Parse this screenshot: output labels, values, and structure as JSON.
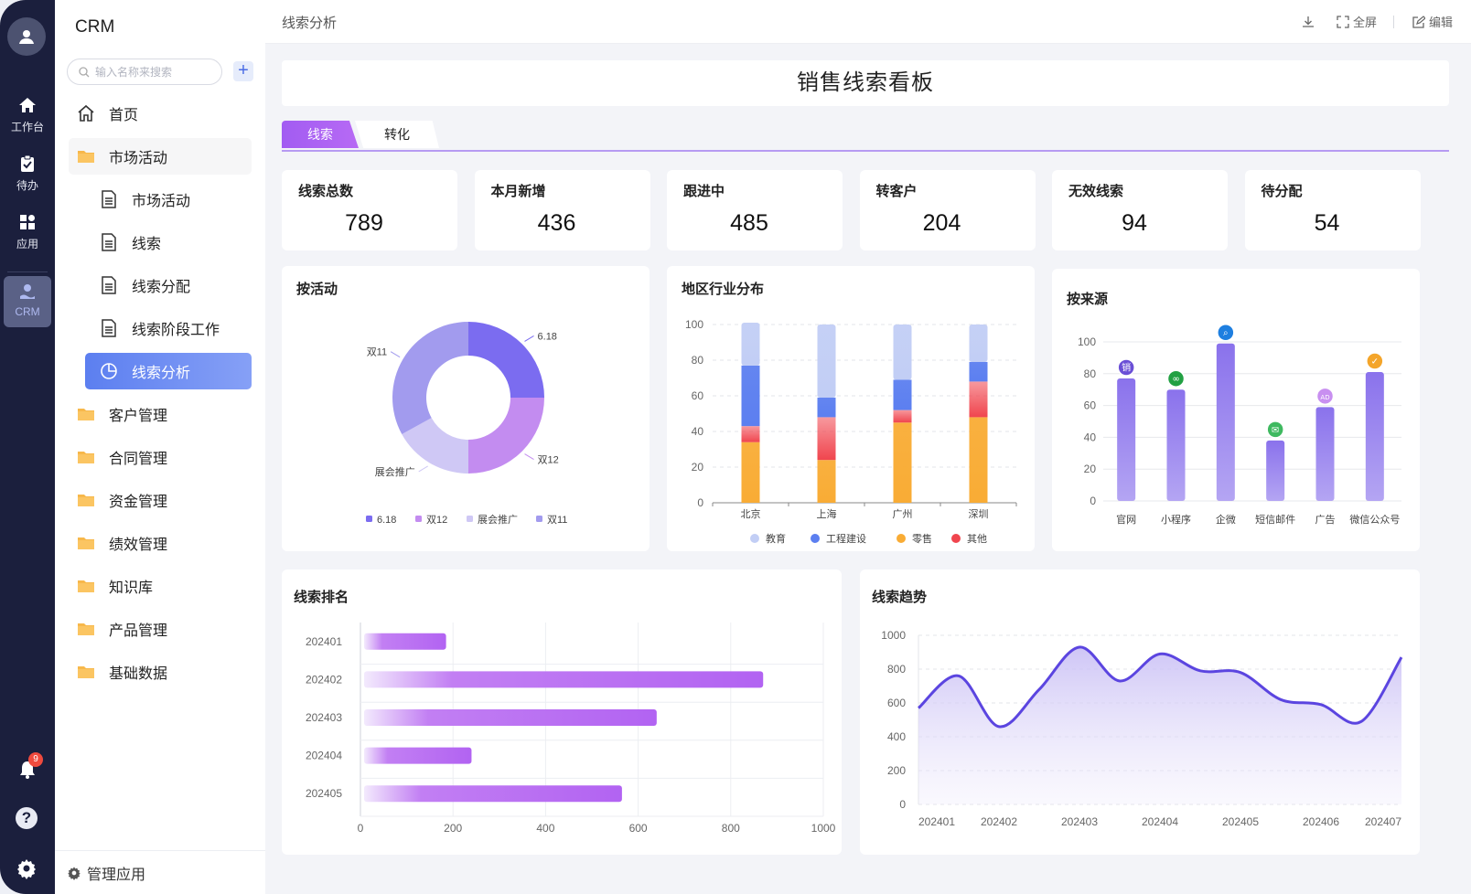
{
  "rail": {
    "items": [
      {
        "label": "工作台",
        "icon": "home-icon"
      },
      {
        "label": "待办",
        "icon": "clipboard-icon"
      },
      {
        "label": "应用",
        "icon": "apps-icon"
      },
      {
        "label": "CRM",
        "icon": "crm-icon"
      }
    ],
    "notification_count": "9"
  },
  "sidebar": {
    "title": "CRM",
    "search_placeholder": "输入名称来搜索",
    "add_label": "+",
    "items": [
      {
        "label": "首页",
        "icon": "house-icon",
        "kind": "top"
      },
      {
        "label": "市场活动",
        "icon": "folder-icon",
        "kind": "folder"
      },
      {
        "label": "市场活动",
        "icon": "document-icon",
        "kind": "sub"
      },
      {
        "label": "线索",
        "icon": "document-icon",
        "kind": "sub"
      },
      {
        "label": "线索分配",
        "icon": "document-icon",
        "kind": "sub"
      },
      {
        "label": "线索阶段工作",
        "icon": "document-icon",
        "kind": "sub"
      },
      {
        "label": "线索分析",
        "icon": "pie-icon",
        "kind": "active"
      },
      {
        "label": "客户管理",
        "icon": "folder-icon",
        "kind": "folder"
      },
      {
        "label": "合同管理",
        "icon": "folder-icon",
        "kind": "folder"
      },
      {
        "label": "资金管理",
        "icon": "folder-icon",
        "kind": "folder"
      },
      {
        "label": "绩效管理",
        "icon": "folder-icon",
        "kind": "folder"
      },
      {
        "label": "知识库",
        "icon": "folder-icon",
        "kind": "folder"
      },
      {
        "label": "产品管理",
        "icon": "folder-icon",
        "kind": "folder"
      },
      {
        "label": "基础数据",
        "icon": "folder-icon",
        "kind": "folder"
      }
    ],
    "footer_label": "管理应用"
  },
  "topbar": {
    "breadcrumb": "线索分析",
    "fullscreen_label": "全屏",
    "edit_label": "编辑"
  },
  "dashboard": {
    "title": "销售线索看板",
    "tabs": [
      "线索",
      "转化"
    ],
    "kpis": [
      {
        "label": "线索总数",
        "value": "789"
      },
      {
        "label": "本月新增",
        "value": "436"
      },
      {
        "label": "跟进中",
        "value": "485"
      },
      {
        "label": "转客户",
        "value": "204"
      },
      {
        "label": "无效线索",
        "value": "94"
      },
      {
        "label": "待分配",
        "value": "54"
      }
    ],
    "colors": {
      "accent": "#a25cf2",
      "blue": "#5c7ff0",
      "orange": "#f9ac35",
      "red": "#f0454e"
    }
  },
  "chart_data": [
    {
      "type": "pie",
      "title": "按活动",
      "categories": [
        "6.18",
        "双12",
        "展会推广",
        "双11"
      ],
      "values": [
        25,
        25,
        17,
        33
      ],
      "colors": [
        "#7b6cf0",
        "#c38cf0",
        "#cfc8f5",
        "#a29bee"
      ],
      "legend": "bottom"
    },
    {
      "type": "bar",
      "stacked": true,
      "title": "地区行业分布",
      "categories": [
        "北京",
        "上海",
        "广州",
        "深圳"
      ],
      "series": [
        {
          "name": "零售",
          "values": [
            34,
            24,
            45,
            48
          ],
          "color": "#f9ac35"
        },
        {
          "name": "其他",
          "values": [
            9,
            24,
            7,
            20
          ],
          "color": "#f0454e"
        },
        {
          "name": "工程建设",
          "values": [
            34,
            11,
            17,
            11
          ],
          "color": "#5c7ff0"
        },
        {
          "name": "教育",
          "values": [
            24,
            41,
            31,
            21
          ],
          "color": "#c2cef5"
        }
      ],
      "legend_order": [
        "教育",
        "工程建设",
        "零售",
        "其他"
      ],
      "yticks": [
        0,
        20,
        40,
        60,
        80,
        100
      ],
      "ylim": [
        0,
        100
      ],
      "grid": true,
      "legend": "bottom"
    },
    {
      "type": "bar",
      "title": "按来源",
      "categories": [
        "官网",
        "小程序",
        "企微",
        "短信邮件",
        "广告",
        "微信公众号"
      ],
      "values": [
        77,
        70,
        99,
        38,
        59,
        81
      ],
      "icons": [
        "sales-badge-icon",
        "link-badge-icon",
        "search-badge-icon",
        "mail-badge-icon",
        "ad-badge-icon",
        "check-badge-icon"
      ],
      "icon_colors": [
        "#6a4fd6",
        "#22a043",
        "#1e7fe0",
        "#3fb960",
        "#c88ff0",
        "#f4a52a"
      ],
      "yticks": [
        0,
        20,
        40,
        60,
        80,
        100
      ],
      "ylim": [
        0,
        100
      ],
      "grid": true
    },
    {
      "type": "bar",
      "orientation": "horizontal",
      "title": "线索排名",
      "categories": [
        "202401",
        "202402",
        "202403",
        "202404",
        "202405"
      ],
      "values": [
        185,
        870,
        640,
        240,
        565
      ],
      "xticks": [
        0,
        200,
        400,
        600,
        800,
        1000
      ],
      "xlim": [
        0,
        1000
      ],
      "grid": true
    },
    {
      "type": "area",
      "title": "线索趋势",
      "x": [
        "202401",
        "202401.5",
        "202402",
        "202402.5",
        "202403",
        "202403.5",
        "202404",
        "202404.5",
        "202405",
        "202405.5",
        "202406",
        "202406.5",
        "202407"
      ],
      "xtick_labels": [
        "202401",
        "202402",
        "202403",
        "202404",
        "202405",
        "202406",
        "202407"
      ],
      "values": [
        570,
        760,
        460,
        680,
        930,
        730,
        890,
        790,
        780,
        620,
        590,
        490,
        870
      ],
      "yticks": [
        0,
        200,
        400,
        600,
        800,
        1000
      ],
      "ylim": [
        0,
        1000
      ],
      "grid": true,
      "color": "#5b45e0"
    }
  ]
}
